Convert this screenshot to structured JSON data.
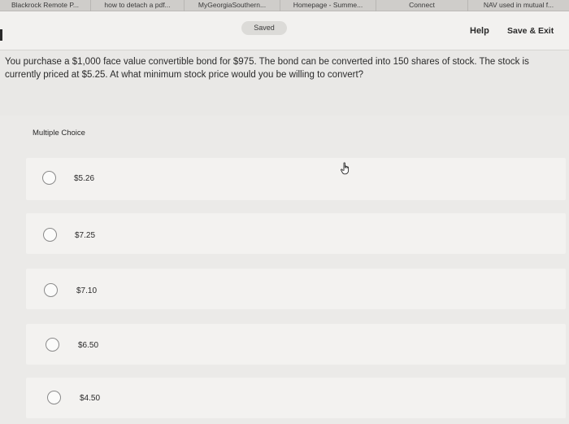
{
  "bookmarks": [
    "Blackrock Remote P...",
    "how to detach a pdf...",
    "MyGeorgiaSouthern...",
    "Homepage - Summe...",
    "Connect",
    "NAV used in mutual f..."
  ],
  "toolbar": {
    "saved_label": "Saved",
    "help_label": "Help",
    "save_exit_label": "Save & Exit"
  },
  "question": {
    "text": "You purchase a $1,000 face value convertible bond for $975. The bond can be converted into 150 shares of stock. The stock is currently priced at $5.25. At what minimum stock price would you be willing to convert?"
  },
  "multiple_choice": {
    "label": "Multiple Choice",
    "options": [
      "$5.26",
      "$7.25",
      "$7.10",
      "$6.50",
      "$4.50"
    ]
  },
  "icons": {
    "cursor": "hand-pointer-icon"
  }
}
